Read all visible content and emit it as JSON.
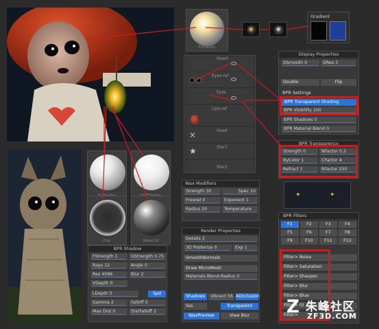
{
  "watermark": {
    "cn": "朱峰社区",
    "en": "ZF3D.COM"
  },
  "spheres": [
    {
      "label": "FxShader"
    },
    {
      "label": "DoFShader"
    },
    {
      "label": "Flat"
    },
    {
      "label": "Metal Gl"
    }
  ],
  "top_sphere_label": "FxPlastic",
  "gradient": {
    "title": "Gradient",
    "left_color": "#050505",
    "right_color": "#1f3f9b"
  },
  "subtools": {
    "items": [
      {
        "label": "Heart"
      },
      {
        "label": "Eyes-ref"
      },
      {
        "label": "Eyes"
      },
      {
        "label": "Lips-ref"
      },
      {
        "label": "Head"
      },
      {
        "label": "Star1"
      },
      {
        "label": "Star2"
      }
    ]
  },
  "display_properties": {
    "title": "Display Properties",
    "dsmooth_label": "DSmooth",
    "dsmooth_value": "0",
    "dres_label": "DRes",
    "dres_value": "3",
    "double_label": "Double",
    "flip_label": "Flip"
  },
  "bpr_settings": {
    "title": "BPR Settings",
    "transparent_shading": "BPR Transparent Shading",
    "visibility_label": "BPR Visibility",
    "visibility_value": "100",
    "shadows_label": "BPR Shadows",
    "shadows_value": "0",
    "material_blend_label": "BPR Material Blend",
    "material_blend_value": "0"
  },
  "bpr_transparency": {
    "title": "BPR Transparency",
    "strength_label": "Strength",
    "strength_value": "0",
    "nfactor_label": "NFactor",
    "nfactor_value": "0.2",
    "bycolor_label": "ByColor",
    "bycolor_value": "1",
    "cfactor_label": "CFactor",
    "cfactor_value": "4",
    "refract_label": "Refract",
    "refract_value": "1",
    "rfactor_label": "RFactor",
    "rfactor_value": "250"
  },
  "wax_modifiers": {
    "title": "Wax Modifiers",
    "strength_label": "Strength",
    "strength_value": "30",
    "spec_label": "Spec",
    "spec_value": "10",
    "fresnel_label": "Fresnel",
    "fresnel_value": "0",
    "exponent_label": "Exponent",
    "exponent_value": "1",
    "radius_label": "Radius",
    "radius_value": "20",
    "temperature_label": "Temperature"
  },
  "render_properties": {
    "title": "Render Properties",
    "details_label": "Details",
    "details_value": "2",
    "posterize_label": "3D Posterize",
    "posterize_value": "0",
    "exp_label": "Exp",
    "exp_value": "1",
    "smoothnormals_label": "SmoothNormals",
    "draw_micromesh_label": "Draw MicroMesh",
    "materials_blend_label": "Materials Blend-Radius",
    "materials_blend_value": "0",
    "shadows_btn": "Shadows",
    "vibrant_label": "Vibrant",
    "vibrant_value": "56",
    "aocclusion_btn": "AOcclusion",
    "sss_btn": "Sss",
    "transparent_btn": "Transparent",
    "waxpreview_btn": "WaxPreview",
    "viewblur_btn": "View Blur"
  },
  "bpr_shadow": {
    "title": "BPR Shadow",
    "fstrength_label": "FStrength",
    "fstrength_value": "1",
    "gstrength_label": "GStrength",
    "gstrength_value": "0.75",
    "rays_label": "Rays",
    "rays_value": "12",
    "angle_label": "Angle",
    "angle_value": "0",
    "res_label": "Res",
    "res_value": "4096",
    "blur_label": "Blur",
    "blur_value": "2",
    "vdepth_label": "VDepth",
    "vdepth_value": "0",
    "ldepth_label": "LDepth",
    "ldepth_value": "0",
    "spd_btn": "Spd",
    "gamma_label": "Gamma",
    "gamma_value": "2",
    "falloff_label": "Falloff",
    "falloff_value": "0",
    "maxdist_label": "Max Dist",
    "maxdist_value": "0",
    "distfalloff_label": "DistFalloff",
    "distfalloff_value": "2"
  },
  "bpr_filters": {
    "title": "BPR Filters",
    "slots": [
      "F1",
      "F2",
      "F3",
      "F4",
      "F5",
      "F6",
      "F7",
      "F8",
      "F9",
      "F10",
      "F11",
      "F12"
    ],
    "filters": [
      "Filter> Noise",
      "Filter> Saturation",
      "Filter> Sharpen",
      "Filter> Blur",
      "Filter> Blue",
      "Filter> Gl",
      "Filter>"
    ]
  }
}
